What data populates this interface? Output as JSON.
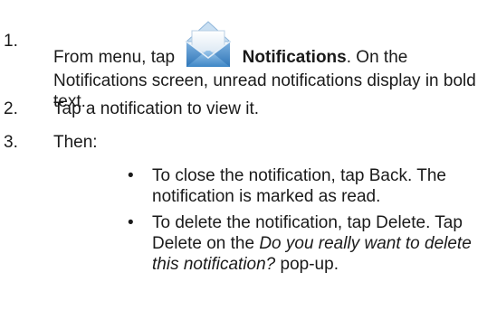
{
  "steps": [
    {
      "number": "1.",
      "before_icon": "From menu, tap",
      "icon": "notifications-envelope-icon",
      "bold_label": "Notifications",
      "after_bold": ". On the Notifications screen, unread notifications display in bold text."
    },
    {
      "number": "2.",
      "text": "Tap a notification to view it."
    },
    {
      "number": "3.",
      "text": "Then:"
    }
  ],
  "bullets": [
    {
      "symbol": "•",
      "text": "To close the notification, tap Back. The notification is marked as read."
    },
    {
      "symbol": "•",
      "text_before": "To delete the notification, tap Delete. Tap Delete on the ",
      "italic": "Do you really want to delete this notification?",
      "text_after": " pop-up."
    }
  ],
  "colors": {
    "text": "#1a1a1a",
    "icon_blue": "#3d86c6",
    "icon_light": "#c9dff2"
  }
}
